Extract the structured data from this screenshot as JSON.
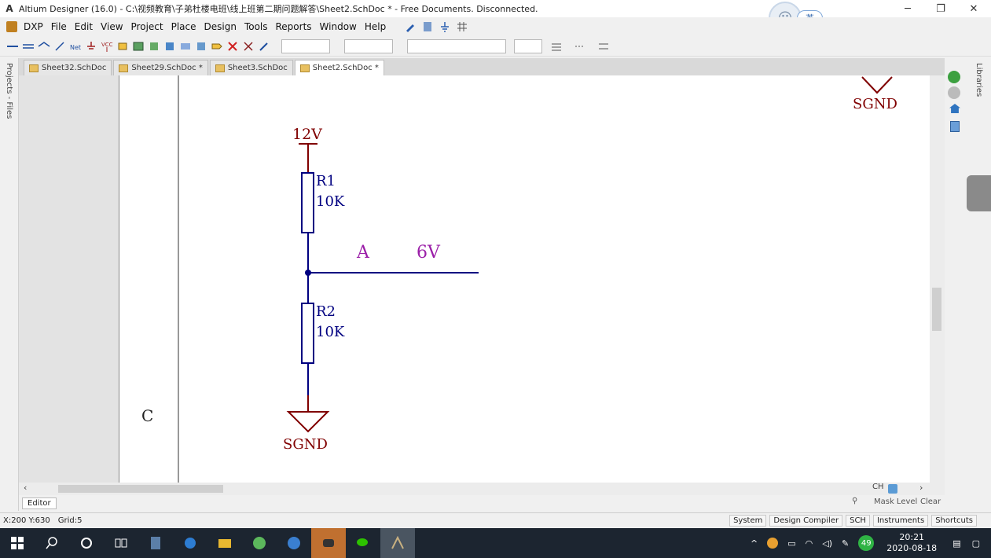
{
  "window": {
    "title": "Altium Designer (16.0) - C:\\视频教育\\子弟杜楼电班\\线上班第二期问题解答\\Sheet2.SchDoc * - Free Documents. Disconnected.",
    "minimize": "─",
    "restore": "❐",
    "close": "✕"
  },
  "avatar": {
    "badge": "英"
  },
  "menu": {
    "items": [
      "DXP",
      "File",
      "Edit",
      "View",
      "Project",
      "Place",
      "Design",
      "Tools",
      "Reports",
      "Window",
      "Help"
    ]
  },
  "panels": {
    "left_label": "Projects - Files",
    "right_label": "Libraries"
  },
  "tabs": [
    {
      "label": "Sheet32.SchDoc"
    },
    {
      "label": "Sheet29.SchDoc *"
    },
    {
      "label": "Sheet3.SchDoc"
    },
    {
      "label": "Sheet2.SchDoc *"
    }
  ],
  "schematic": {
    "border_letter": "C",
    "top_right_net": "SGND",
    "power_label": "12V",
    "r1_designator": "R1",
    "r1_value": "10K",
    "node_label": "A",
    "node_voltage": "6V",
    "r2_designator": "R2",
    "r2_value": "10K",
    "ground_label": "SGND",
    "colors": {
      "wire": "#000080",
      "component": "#000080",
      "power": "#800000",
      "annotation": "#9b1fa8",
      "text": "#000080"
    }
  },
  "editor": {
    "tab": "Editor",
    "ch_label": "CH",
    "mask_level": "Mask Level",
    "clear": "Clear"
  },
  "status": {
    "coords": "X:200 Y:630",
    "grid": "Grid:5",
    "buttons": [
      "System",
      "Design Compiler",
      "SCH",
      "Instruments",
      "Shortcuts"
    ]
  },
  "taskbar": {
    "time": "20:21",
    "date": "2020-08-18",
    "badge_count": "49"
  }
}
